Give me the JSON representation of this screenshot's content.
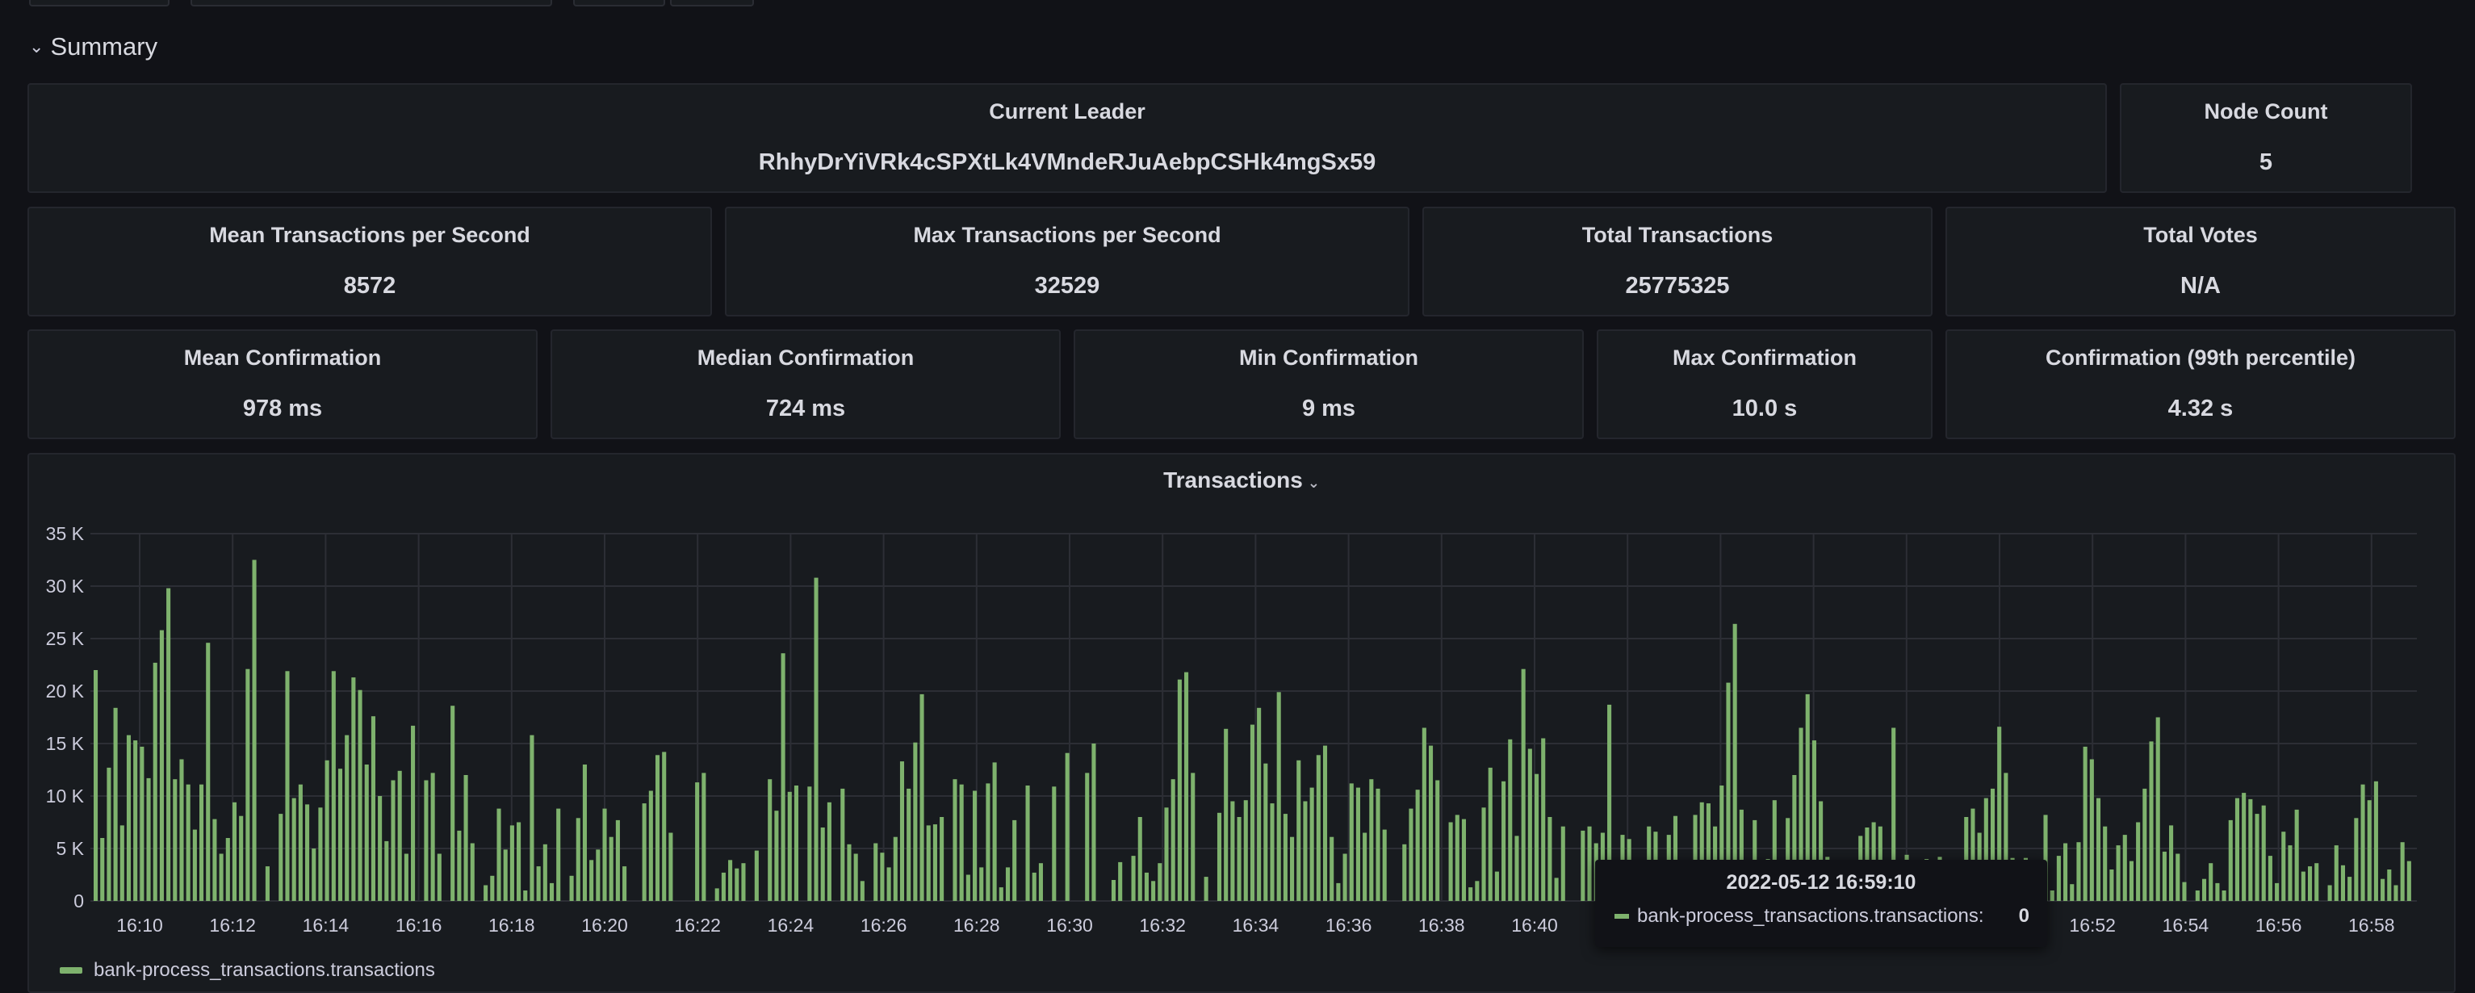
{
  "row": {
    "title": "Summary"
  },
  "stats": {
    "current_leader": {
      "title": "Current Leader",
      "value": "RhhyDrYiVRk4cSPXtLk4VMndeRJuAebpCSHk4mgSx59"
    },
    "node_count": {
      "title": "Node Count",
      "value": "5"
    },
    "mean_tps": {
      "title": "Mean Transactions per Second",
      "value": "8572"
    },
    "max_tps": {
      "title": "Max Transactions per Second",
      "value": "32529"
    },
    "total_tx": {
      "title": "Total Transactions",
      "value": "25775325"
    },
    "total_votes": {
      "title": "Total Votes",
      "value": "N/A"
    },
    "mean_conf": {
      "title": "Mean Confirmation",
      "value": "978 ms"
    },
    "median_conf": {
      "title": "Median Confirmation",
      "value": "724 ms"
    },
    "min_conf": {
      "title": "Min Confirmation",
      "value": "9 ms"
    },
    "max_conf": {
      "title": "Max Confirmation",
      "value": "10.0 s"
    },
    "p99_conf": {
      "title": "Confirmation (99th percentile)",
      "value": "4.32 s"
    }
  },
  "tooltip": {
    "time": "2022-05-12 16:59:10",
    "series": "bank-process_transactions.transactions:",
    "value": "0"
  },
  "colors": {
    "series": "#7eb26d",
    "background": "#111217",
    "panel": "#181b1f"
  },
  "chart_data": {
    "type": "bar",
    "title": "Transactions",
    "x_ticks": [
      "16:10",
      "16:12",
      "16:14",
      "16:16",
      "16:18",
      "16:20",
      "16:22",
      "16:24",
      "16:26",
      "16:28",
      "16:30",
      "16:32",
      "16:34",
      "16:36",
      "16:38",
      "16:40",
      "16:42",
      "16:44",
      "16:46",
      "16:48",
      "16:50",
      "16:52",
      "16:54",
      "16:56",
      "16:58"
    ],
    "y_ticks": [
      "0",
      "5 K",
      "10 K",
      "15 K",
      "20 K",
      "25 K",
      "30 K",
      "35 K"
    ],
    "ylim": [
      0,
      35000
    ],
    "grid": true,
    "legend": "bottom-left",
    "series": [
      {
        "name": "bank-process_transactions.transactions",
        "values": [
          22000,
          6000,
          12700,
          18400,
          7200,
          15800,
          15300,
          14700,
          11700,
          22700,
          25800,
          29800,
          11600,
          13500,
          11100,
          6800,
          11100,
          24600,
          7800,
          4500,
          6000,
          9400,
          8100,
          22100,
          32500,
          0,
          3300,
          0,
          8300,
          21900,
          9800,
          11100,
          9200,
          5000,
          8900,
          13400,
          21900,
          12600,
          15800,
          21300,
          20100,
          13000,
          17600,
          10000,
          5700,
          11500,
          12400,
          4500,
          16700,
          0,
          11500,
          12200,
          4500,
          0,
          18600,
          6700,
          12000,
          5500,
          0,
          1500,
          2400,
          8800,
          4900,
          7200,
          7500,
          1000,
          15800,
          3300,
          5400,
          1700,
          8800,
          0,
          2400,
          7900,
          13000,
          3900,
          4900,
          8800,
          6100,
          7700,
          3300,
          0,
          0,
          9300,
          10500,
          13900,
          14200,
          6500,
          0,
          0,
          0,
          11300,
          12200,
          0,
          1200,
          2700,
          3900,
          3100,
          3600,
          0,
          4800,
          0,
          11600,
          8600,
          23600,
          10400,
          11000,
          0,
          10900,
          30800,
          7000,
          9400,
          0,
          10700,
          5400,
          4500,
          1900,
          0,
          5500,
          4600,
          3200,
          6100,
          13300,
          10700,
          15100,
          19700,
          7200,
          7300,
          8000,
          0,
          11600,
          11100,
          2500,
          10500,
          3200,
          11200,
          13200,
          1300,
          3200,
          7700,
          0,
          11000,
          2700,
          3600,
          0,
          10900,
          0,
          14100,
          0,
          0,
          12200,
          15000,
          0,
          0,
          2000,
          3700,
          0,
          4300,
          8000,
          2700,
          1900,
          3600,
          8900,
          11600,
          21100,
          21800,
          12200,
          0,
          2300,
          0,
          8400,
          16400,
          9500,
          8000,
          9600,
          16800,
          18400,
          13100,
          9300,
          19900,
          8300,
          6100,
          13400,
          9500,
          10800,
          13900,
          14800,
          6100,
          1700,
          4500,
          11200,
          10800,
          6500,
          11600,
          10700,
          6800,
          0,
          0,
          5400,
          8800,
          10600,
          16500,
          14800,
          11500,
          0,
          7500,
          8200,
          7800,
          1300,
          1900,
          8900,
          12700,
          2800,
          11400,
          15400,
          6200,
          22100,
          14500,
          12100,
          15500,
          8000,
          2200,
          7100,
          0,
          0,
          6700,
          7100,
          5500,
          6500,
          18700,
          0,
          6300,
          5900,
          1200,
          0,
          7100,
          6600,
          0,
          6300,
          8100,
          2000,
          0,
          8200,
          9400,
          9300,
          7100,
          11000,
          20800,
          26400,
          8700,
          0,
          7700,
          3300,
          4000,
          9600,
          0,
          7900,
          12000,
          16500,
          19700,
          15300,
          9500,
          4200,
          1500,
          3600,
          0,
          3600,
          6200,
          7000,
          7500,
          7100,
          1200,
          16500,
          0,
          4400,
          0,
          0,
          4000,
          0,
          4200,
          0,
          0,
          0,
          8000,
          8800,
          6500,
          9800,
          10700,
          16600,
          12200,
          4100,
          0,
          4100,
          0,
          2000,
          8200,
          1000,
          4300,
          5500,
          1600,
          5600,
          14700,
          13500,
          9800,
          7100,
          3000,
          5300,
          6300,
          3800,
          7500,
          10700,
          15200,
          17500,
          4700,
          7200,
          4500,
          1800,
          0,
          1000,
          2100,
          3600,
          1700,
          1000,
          7700,
          9800,
          10300,
          9700,
          8300,
          9100,
          4300,
          1700,
          6600,
          5300,
          8700,
          2800,
          3300,
          3600,
          0,
          1500,
          5300,
          3400,
          2300,
          7900,
          11100,
          9600,
          11400,
          2100,
          3000,
          1500,
          5600,
          3800
        ]
      }
    ]
  }
}
